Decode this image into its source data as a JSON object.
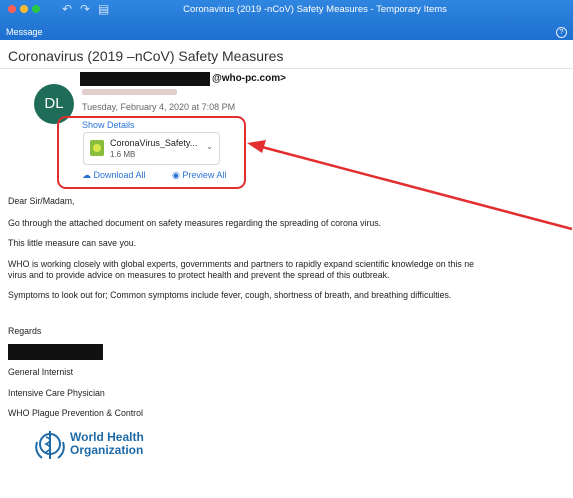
{
  "window": {
    "title": "Coronavirus (2019 -nCoV) Safety Measures - Temporary Items",
    "tab": "Message",
    "help": "?"
  },
  "email": {
    "subject": "Coronavirus (2019 –nCoV) Safety Measures",
    "avatar_initials": "DL",
    "sender_domain": "@who-pc.com>",
    "date": "Tuesday, February 4, 2020 at 7:08 PM",
    "show_details": "Show Details"
  },
  "attachment": {
    "name": "CoronaVirus_Safety...",
    "size": "1.6 MB",
    "download_all": "Download All",
    "preview_all": "Preview All"
  },
  "body": {
    "greeting": "Dear Sir/Madam,",
    "p1": "Go through the attached document on safety measures regarding the spreading of corona virus.",
    "p2": "This little measure can save you.",
    "p3_line1": "WHO is working closely with global experts, governments and partners to rapidly expand scientific knowledge on this ne",
    "p3_line2": "virus and to provide advice on measures to protect health and prevent the spread of this outbreak.",
    "p4": "Symptoms to look out for; Common symptoms include fever, cough, shortness of breath, and breathing difficulties."
  },
  "signature": {
    "regards": "Regards",
    "line1": "General Internist",
    "line2": "Intensive Care Physician",
    "line3": "WHO Plague Prevention & Control",
    "logo_line1": "World Health",
    "logo_line2": "Organization"
  },
  "icons": {
    "undo": "undo-icon",
    "redo": "redo-icon",
    "save": "save-icon",
    "attachment": "green-file-icon",
    "download": "download-cloud-icon",
    "preview": "eye-icon",
    "chevron": "chevron-down-icon"
  },
  "colors": {
    "titlebar": "#2f86e0",
    "link": "#2a73d6",
    "annotation_red": "#e22e2e",
    "avatar": "#1f6c58",
    "who_blue": "#1d6aa8"
  }
}
